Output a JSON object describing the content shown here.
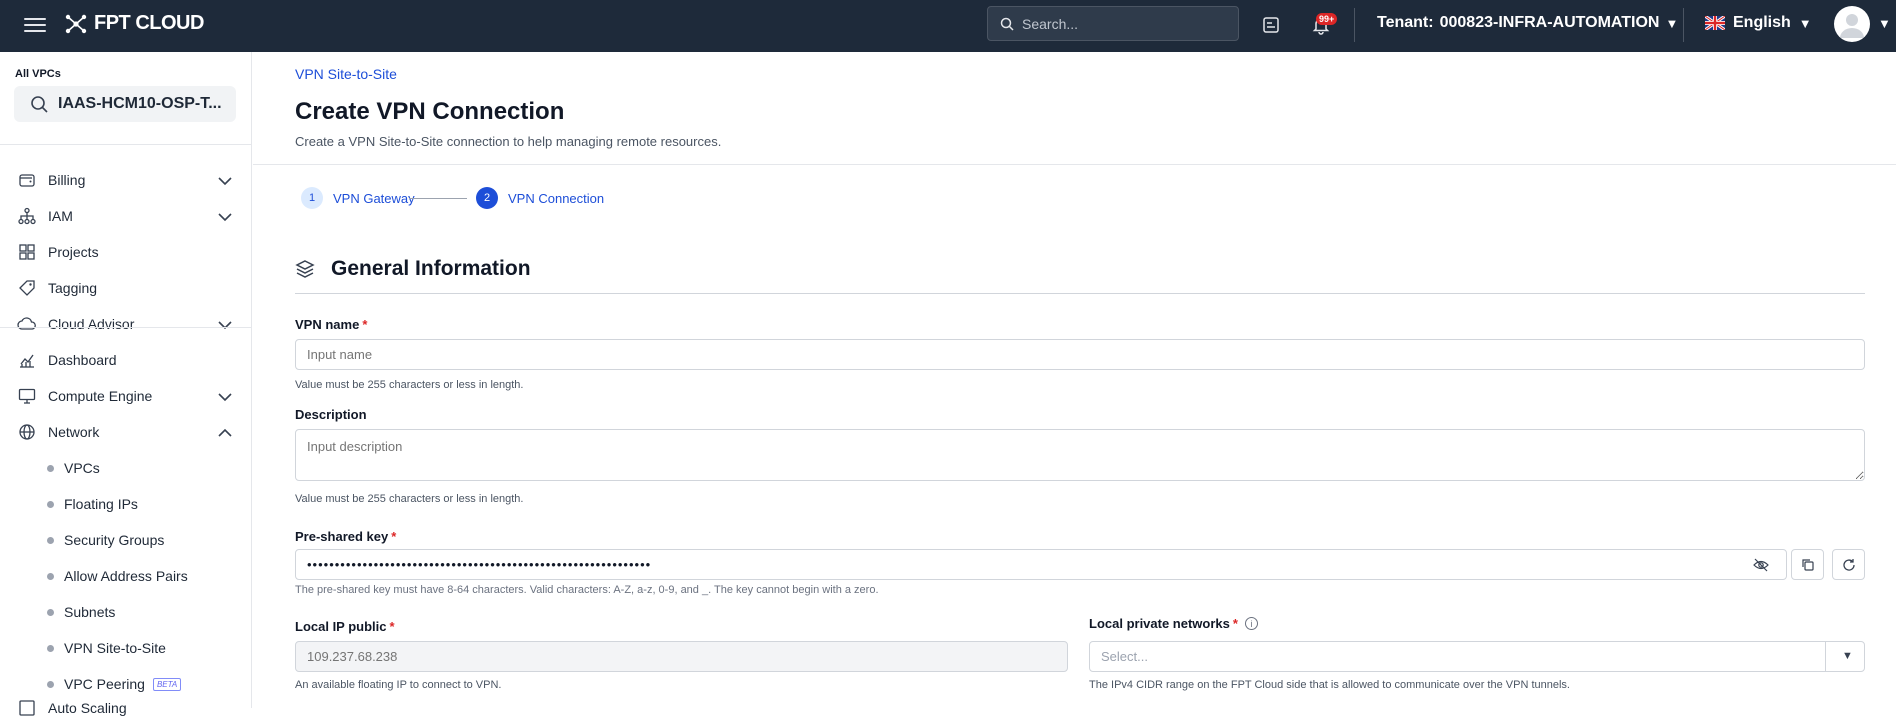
{
  "topbar": {
    "logo_text": "FPT CLOUD",
    "search_placeholder": "Search...",
    "notification_count": "99+",
    "tenant_label": "Tenant:",
    "tenant_value": "000823-INFRA-AUTOMATION",
    "language": "English"
  },
  "sidebar": {
    "vpc_label": "All VPCs",
    "vpc_selected": "IAAS-HCM10-OSP-T...",
    "items": [
      {
        "label": "Billing",
        "icon": "wallet-icon",
        "expandable": true
      },
      {
        "label": "IAM",
        "icon": "org-chart-icon",
        "expandable": true
      },
      {
        "label": "Projects",
        "icon": "grid-icon",
        "expandable": false
      },
      {
        "label": "Tagging",
        "icon": "tag-icon",
        "expandable": false
      },
      {
        "label": "Cloud Advisor",
        "icon": "cloud-icon",
        "expandable": true
      },
      {
        "label": "Dashboard",
        "icon": "chart-icon",
        "expandable": false
      },
      {
        "label": "Compute Engine",
        "icon": "monitor-icon",
        "expandable": true
      },
      {
        "label": "Network",
        "icon": "globe-icon",
        "expandable": true,
        "expanded": true
      }
    ],
    "network_sub": [
      {
        "label": "VPCs"
      },
      {
        "label": "Floating IPs"
      },
      {
        "label": "Security Groups"
      },
      {
        "label": "Allow Address Pairs"
      },
      {
        "label": "Subnets"
      },
      {
        "label": "VPN Site-to-Site"
      },
      {
        "label": "VPC Peering",
        "badge": "BETA"
      }
    ],
    "cut_item": "Auto Scaling"
  },
  "main": {
    "breadcrumb": "VPN Site-to-Site",
    "title": "Create VPN Connection",
    "subtitle": "Create a VPN Site-to-Site connection to help managing remote resources.",
    "steps": [
      {
        "num": "1",
        "label": "VPN Gateway",
        "active": false
      },
      {
        "num": "2",
        "label": "VPN Connection",
        "active": true
      }
    ],
    "section_title": "General Information",
    "fields": {
      "vpn_name": {
        "label": "VPN name",
        "placeholder": "Input name",
        "hint": "Value must be 255 characters or less in length."
      },
      "description": {
        "label": "Description",
        "placeholder": "Input description",
        "hint": "Value must be 255 characters or less in length."
      },
      "psk": {
        "label": "Pre-shared key",
        "value": "••••••••••••••••••••••••••••••••••••••••••••••••••••••••••••••",
        "hint": "The pre-shared key must have 8-64 characters. Valid characters: A-Z, a-z, 0-9, and _. The key cannot begin with a zero."
      },
      "local_ip": {
        "label": "Local IP public",
        "placeholder": "109.237.68.238",
        "hint": "An available floating IP to connect to VPN."
      },
      "local_networks": {
        "label": "Local private networks",
        "placeholder": "Select...",
        "hint": "The IPv4 CIDR range on the FPT Cloud side that is allowed to communicate over the VPN tunnels."
      }
    }
  },
  "colors": {
    "topbar": "#1e2a3a",
    "accent": "#1d4ed8",
    "required": "#dc2626"
  }
}
